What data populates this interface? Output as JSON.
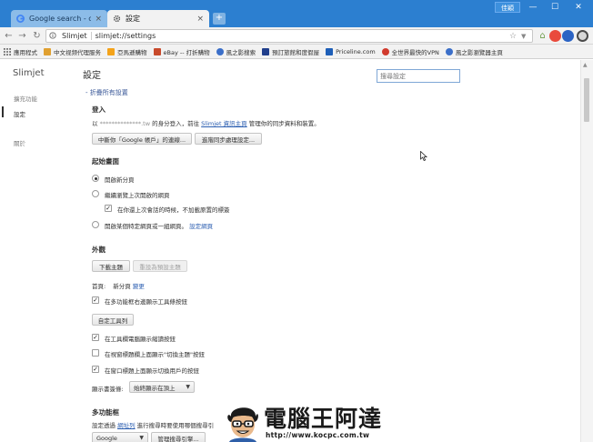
{
  "window": {
    "tabs": [
      {
        "title": "Google search - custo",
        "active": false
      },
      {
        "title": "設定",
        "active": true
      }
    ],
    "new_tab": "+",
    "user_badge": "佳穎",
    "controls": {
      "minimize": "—",
      "maximize": "☐",
      "close": "✕"
    }
  },
  "toolbar": {
    "brand": "Slimjet",
    "url": "slimjet://settings"
  },
  "bookmarks": [
    {
      "label": "應用程式",
      "color": "#7a7a7a"
    },
    {
      "label": "中文视频代理服务",
      "color": "#e0a030"
    },
    {
      "label": "亞馬遜購物",
      "color": "#f4a31a"
    },
    {
      "label": "eBay -- 打折購物",
      "color": "#c84a2c"
    },
    {
      "label": "風之影搜索",
      "color": "#3b6fc9"
    },
    {
      "label": "預訂旅館和度假屋",
      "color": "#213f8c"
    },
    {
      "label": "Priceline.com",
      "color": "#1e5fb8"
    },
    {
      "label": "全世界最快的VPN",
      "color": "#d13b2e"
    },
    {
      "label": "風之影瀏覽器主頁",
      "color": "#3b6fc9"
    }
  ],
  "sidebar": {
    "brand": "Slimjet",
    "items": [
      {
        "label": "擴充功能",
        "active": false
      },
      {
        "label": "設定",
        "active": true
      },
      {
        "label": "關於",
        "active": false
      }
    ]
  },
  "settings": {
    "title": "設定",
    "search_placeholder": "搜尋設定",
    "collapse_link": "- 折疊所有設置",
    "signin": {
      "title": "登入",
      "text_prefix": "以",
      "email": "**************.tw",
      "text_middle": "的身分登入，前往",
      "link": "Slimjet 資訊主頁",
      "text_suffix": "管理你的同步資料和裝置。",
      "disconnect_button": "中斷你「Google 帳戶」的連線...",
      "sync_button": "進階同步處理設定..."
    },
    "startup": {
      "title": "起始畫面",
      "option_newtab": "開啟新分頁",
      "option_continue": "繼續瀏覽上次開啟的網頁",
      "option_lazyload": "在你還上次會話的時候，不加載原置的標簽",
      "option_specific": "開啟某個特定網頁或一組網頁。",
      "set_pages_link": "設定網頁"
    },
    "appearance": {
      "title": "外觀",
      "download_theme": "下載主題",
      "reset_theme": "重設為預設主題",
      "homepage_label": "首頁:",
      "homepage_value": "新分頁",
      "homepage_change": "變更",
      "show_toolbar_buttons": "在多功能框右邊顯示工具條按鈕",
      "custom_toolbar": "自定工具列",
      "show_thumbnail_buttons": "在工具欄電腦顯示縮讀按鈕",
      "show_theme_toggle": "在視窗標題欄上面顯示\"切換主題\"按鈕",
      "show_window_switcher": "在窗口標題上面顯示切換用戶的按鈕",
      "tabs_position_label": "顯示書簽條:",
      "tabs_position_value": "始終顯示在頂上"
    },
    "omnibox": {
      "title": "多功能框",
      "text_prefix": "設定透過",
      "link": "網址列",
      "text_suffix": "進行搜尋時要使用哪個搜尋引",
      "engine_value": "Google",
      "manage_button": "管理搜尋引擎..."
    }
  },
  "watermark": {
    "title": "電腦王阿達",
    "url": "http://www.kocpc.com.tw"
  }
}
